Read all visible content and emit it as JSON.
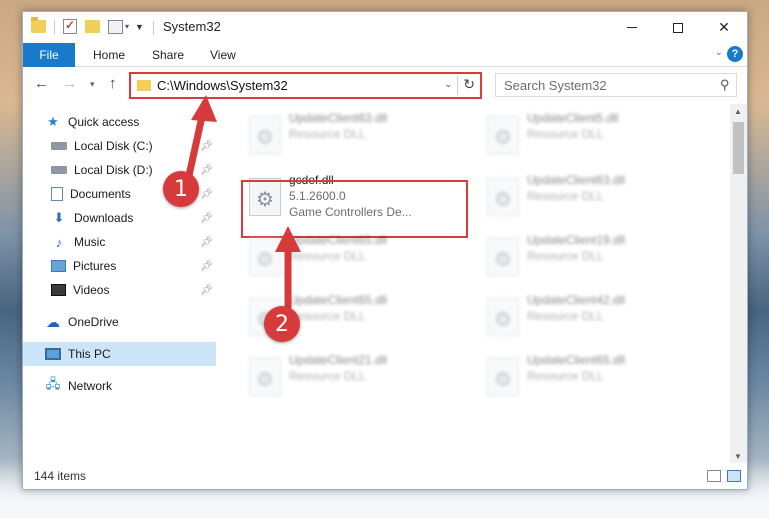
{
  "window": {
    "title": "System32"
  },
  "ribbon": {
    "file_tab": "File",
    "tabs": [
      "Home",
      "Share",
      "View"
    ],
    "help_label": "?"
  },
  "nav": {
    "back_glyph": "←",
    "forward_glyph": "→",
    "recent_glyph": "▾",
    "up_glyph": "↑"
  },
  "address": {
    "path": "C:\\Windows\\System32",
    "refresh_glyph": "↻",
    "dropdown_glyph": "⌄"
  },
  "search": {
    "placeholder": "Search System32",
    "icon": "search-icon"
  },
  "sidebar": {
    "items": [
      {
        "label": "Quick access",
        "icon": "star-icon",
        "pinned": false
      },
      {
        "label": "Local Disk (C:)",
        "icon": "disk-icon",
        "pinned": true
      },
      {
        "label": "Local Disk (D:)",
        "icon": "disk-icon",
        "pinned": true
      },
      {
        "label": "Documents",
        "icon": "documents-icon",
        "pinned": true
      },
      {
        "label": "Downloads",
        "icon": "downloads-icon",
        "pinned": true
      },
      {
        "label": "Music",
        "icon": "music-icon",
        "pinned": true
      },
      {
        "label": "Pictures",
        "icon": "pictures-icon",
        "pinned": true
      },
      {
        "label": "Videos",
        "icon": "videos-icon",
        "pinned": true
      },
      {
        "label": "OneDrive",
        "icon": "cloud-icon",
        "pinned": false
      },
      {
        "label": "This PC",
        "icon": "pc-icon",
        "pinned": false,
        "selected": true
      },
      {
        "label": "Network",
        "icon": "network-icon",
        "pinned": false
      }
    ]
  },
  "files": {
    "left_column": [
      {
        "name": "UpdateClient63.dll",
        "type": "Resource DLL"
      },
      {
        "name": "gcdef.dll",
        "version": "5.1.2600.0",
        "description": "Game Controllers De...",
        "highlighted": true
      },
      {
        "name": "UpdateClient65.dll",
        "type": "Resource DLL"
      },
      {
        "name": "UpdateClient65.dll",
        "type": "Resource DLL"
      },
      {
        "name": "UpdateClient21.dll",
        "type": "Resource DLL"
      }
    ],
    "right_column": [
      {
        "name": "UpdateClient5.dll",
        "type": "Resource DLL"
      },
      {
        "name": "UpdateClient63.dll",
        "type": "Resource DLL"
      },
      {
        "name": "UpdateClient19.dll",
        "type": "Resource DLL"
      },
      {
        "name": "UpdateClient42.dll",
        "type": "Resource DLL"
      },
      {
        "name": "UpdateClient65.dll",
        "type": "Resource DLL"
      }
    ]
  },
  "status": {
    "item_count": "144 items"
  },
  "annotations": {
    "callout_1": "1",
    "callout_2": "2",
    "color": "#d63a3a"
  },
  "colors": {
    "accent": "#1979ca",
    "highlight": "#d93b3b",
    "selected_bg": "#cce4f7"
  }
}
